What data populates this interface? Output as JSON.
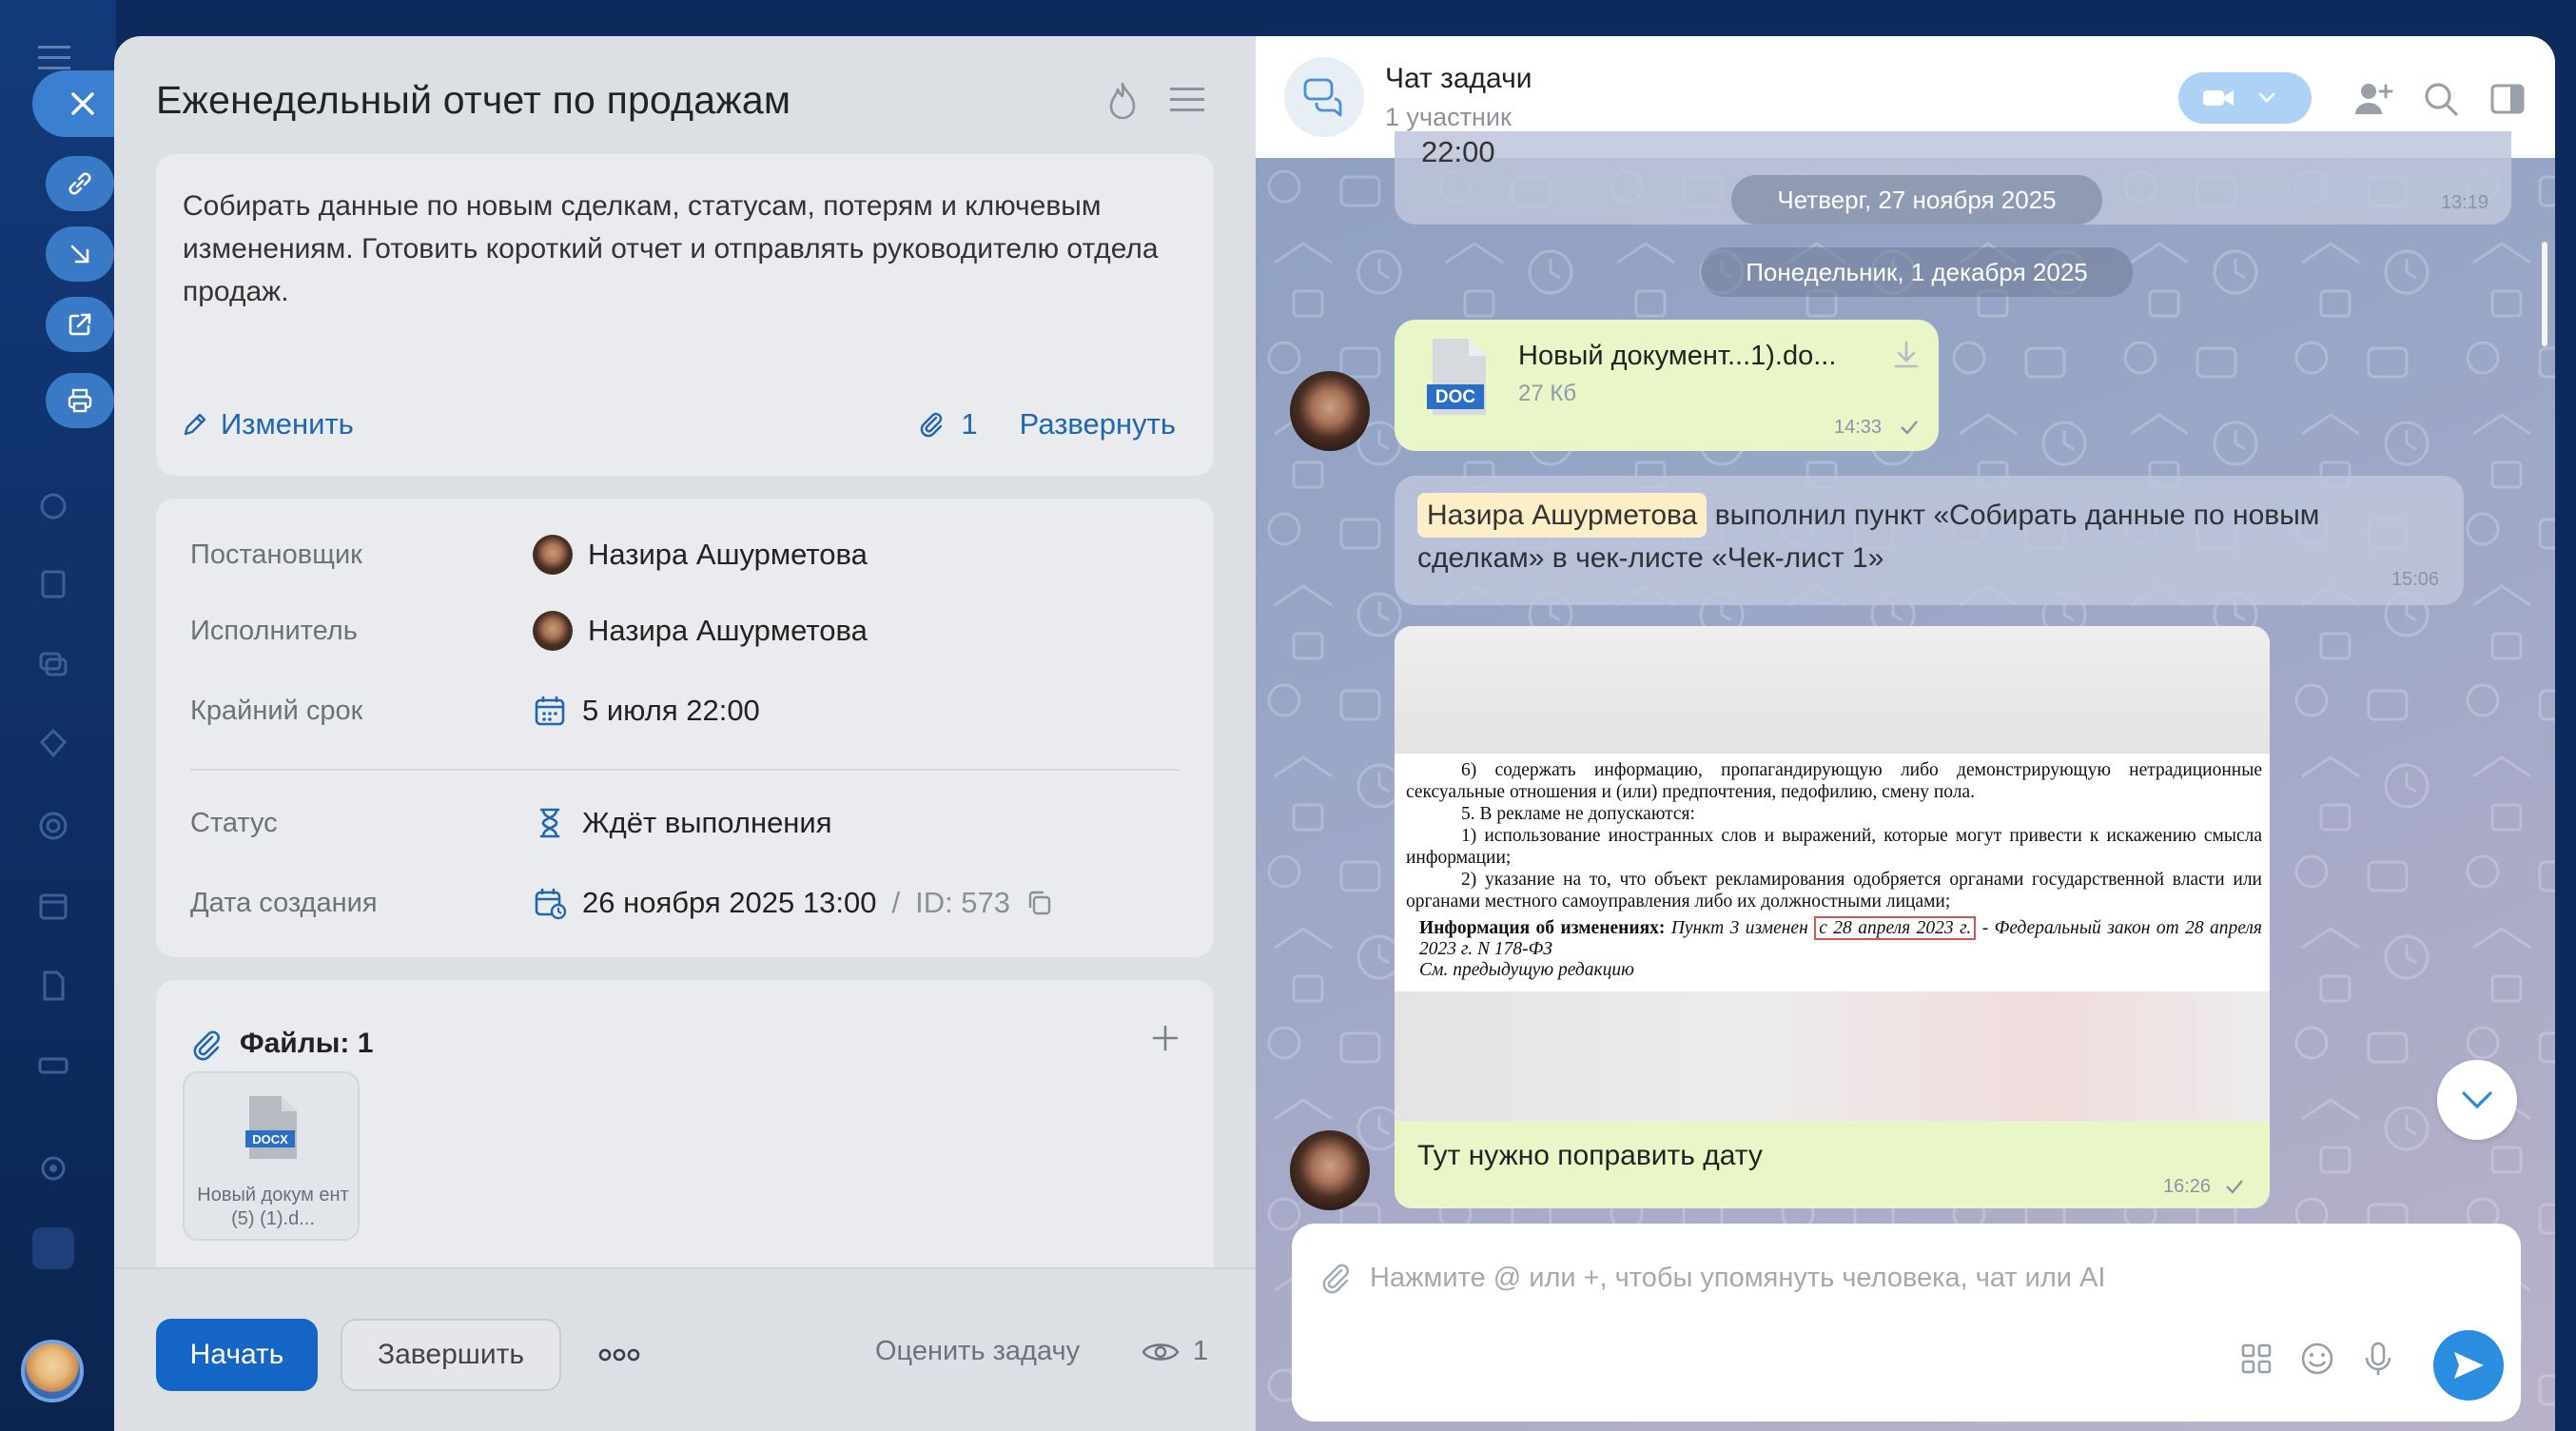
{
  "task": {
    "title": "Еженедельный отчет по продажам",
    "description": "Собирать данные по новым сделкам, статусам, потерям и ключевым изменениям. Готовить короткий отчет и отправлять руководителю отдела продаж.",
    "edit_label": "Изменить",
    "attachments_count": "1",
    "expand_label": "Развернуть",
    "details": {
      "creator_label": "Постановщик",
      "creator_name": "Назира Ашурметова",
      "assignee_label": "Исполнитель",
      "assignee_name": "Назира Ашурметова",
      "deadline_label": "Крайний срок",
      "deadline_value": "5 июля 22:00",
      "status_label": "Статус",
      "status_value": "Ждёт выполнения",
      "created_label": "Дата создания",
      "created_value": "26 ноября 2025 13:00",
      "id_sep": "/",
      "id_value": "ID: 573"
    },
    "files": {
      "title": "Файлы: 1",
      "file_name": "Новый докум ент (5) (1).d...",
      "file_badge": "DOCX"
    },
    "footer": {
      "start_label": "Начать",
      "finish_label": "Завершить",
      "rate_label": "Оценить задачу",
      "views_count": "1"
    }
  },
  "chat": {
    "title": "Чат задачи",
    "subtitle": "1 участник",
    "messages": {
      "partial_time_text": "22:00",
      "partial_time": "13:19",
      "date1": "Четверг, 27 ноября 2025",
      "date2": "Понедельник, 1 декабря 2025",
      "file_msg": {
        "badge": "DOC",
        "name": "Новый документ...1).do...",
        "size": "27 Кб",
        "time": "14:33"
      },
      "system_msg": {
        "mention": "Назира Ашурметова",
        "text": "выполнил пункт «Собирать данные по новым сделкам» в чек-листе «Чек-лист 1»",
        "time": "15:06"
      },
      "image_msg": {
        "doc_p1": "6) содержать информацию, пропагандирующую либо демонстрирующую нетрадиционные сексуальные отношения и (или) предпочтения, педофилию, смену пола.",
        "doc_p2": "5. В рекламе не допускаются:",
        "doc_p3": "1) использование иностранных слов и выражений, которые могут привести к искажению смысла информации;",
        "doc_p4": "2) указание на то, что объект рекламирования одобряется органами государственной власти или органами местного самоуправления либо их должностными лицами;",
        "doc_info_label": "Информация об изменениях:",
        "doc_info_pre": "Пункт 3 изменен",
        "doc_info_highlight": "с 28 апреля 2023 г.",
        "doc_info_post": "- Федеральный закон от 28 апреля 2023 г. N 178-ФЗ",
        "doc_info_prev": "См. предыдущую редакцию",
        "caption": "Тут нужно поправить дату",
        "time": "16:26"
      }
    },
    "composer": {
      "placeholder": "Нажмите @ или +, чтобы упомянуть человека, чат или AI"
    }
  },
  "colors": {
    "accent": "#1565c6",
    "link": "#2066b0",
    "green_bubble": "#e9f6c8",
    "send": "#2a8de0"
  }
}
